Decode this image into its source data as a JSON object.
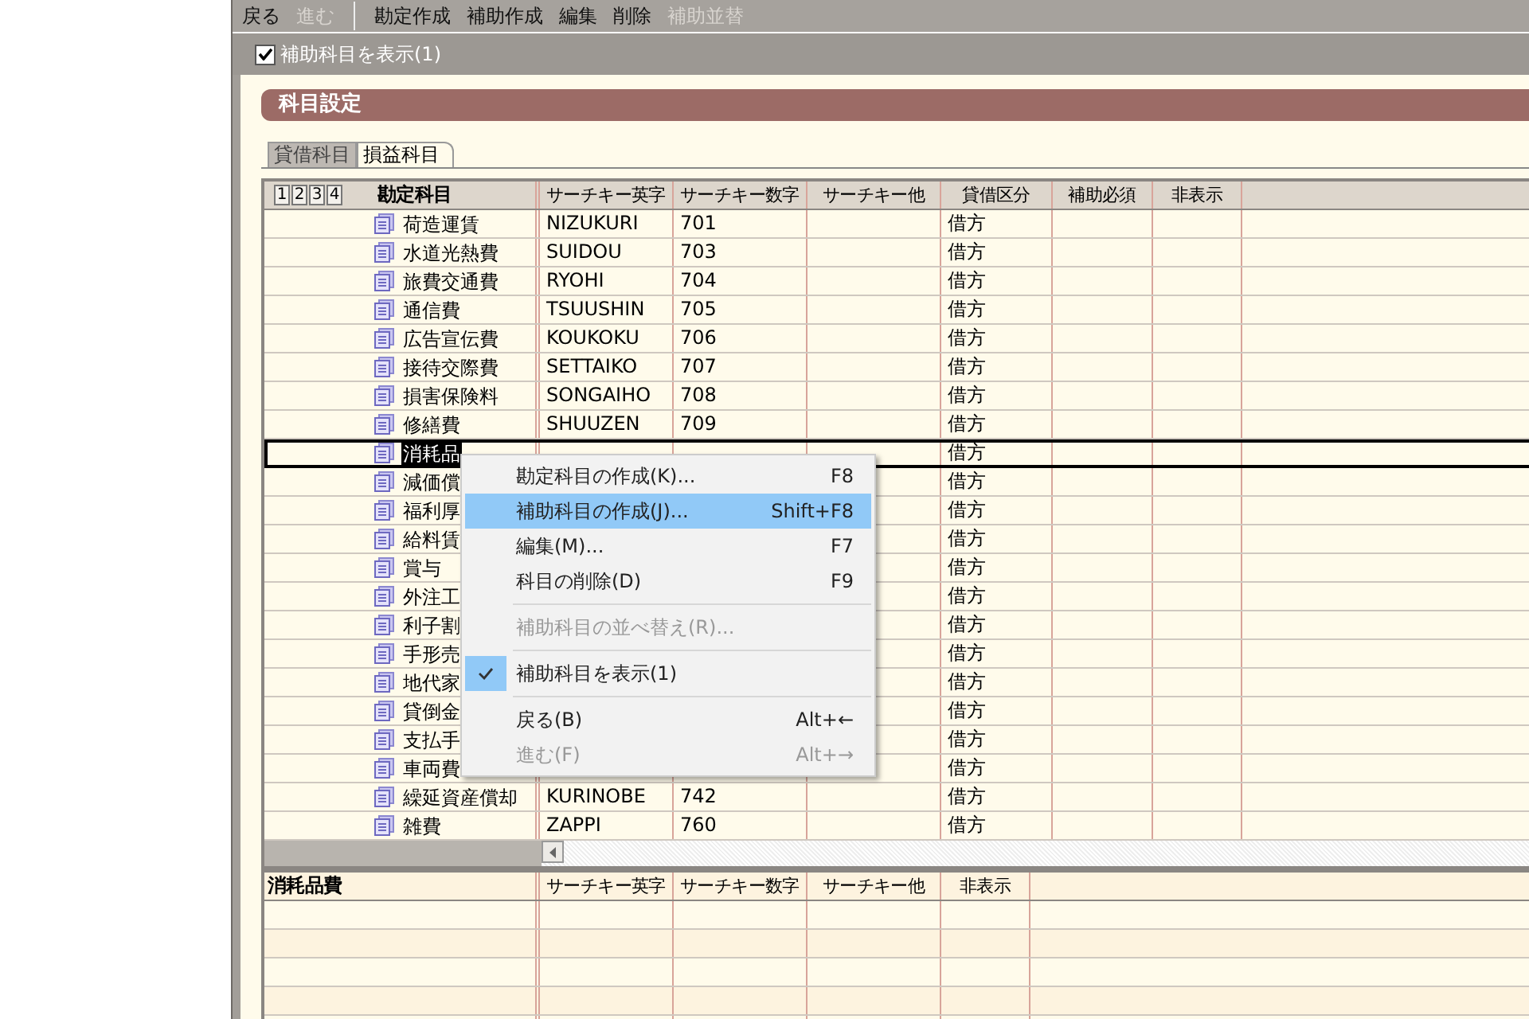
{
  "toolbar": [
    {
      "kind": "button",
      "label": "戻る",
      "disabled": false
    },
    {
      "kind": "button",
      "label": "進む",
      "disabled": true
    },
    {
      "kind": "separator"
    },
    {
      "kind": "button",
      "label": "勘定作成",
      "disabled": false
    },
    {
      "kind": "button",
      "label": "補助作成",
      "disabled": false
    },
    {
      "kind": "button",
      "label": "編集",
      "disabled": false
    },
    {
      "kind": "button",
      "label": "削除",
      "disabled": false
    },
    {
      "kind": "button",
      "label": "補助並替",
      "disabled": true
    }
  ],
  "show_sub_checkbox": {
    "label": "補助科目を表示(1)",
    "checked": true
  },
  "panel_title": "科目設定",
  "tabs": [
    {
      "label": "貸借科目",
      "selected": false
    },
    {
      "label": "損益科目",
      "selected": true
    }
  ],
  "grid": {
    "levels": [
      "1",
      "2",
      "3",
      "4"
    ],
    "columns": [
      "勘定科目",
      "サーチキー英字",
      "サーチキー数字",
      "サーチキー他",
      "貸借区分",
      "補助必須",
      "非表示"
    ],
    "rows": [
      {
        "name": "荷造運賃",
        "en": "NIZUKURI",
        "num": "701",
        "side": "借方",
        "selected": false
      },
      {
        "name": "水道光熱費",
        "en": "SUIDOU",
        "num": "703",
        "side": "借方",
        "selected": false
      },
      {
        "name": "旅費交通費",
        "en": "RYOHI",
        "num": "704",
        "side": "借方",
        "selected": false
      },
      {
        "name": "通信費",
        "en": "TSUUSHIN",
        "num": "705",
        "side": "借方",
        "selected": false
      },
      {
        "name": "広告宣伝費",
        "en": "KOUKOKU",
        "num": "706",
        "side": "借方",
        "selected": false
      },
      {
        "name": "接待交際費",
        "en": "SETTAIKO",
        "num": "707",
        "side": "借方",
        "selected": false
      },
      {
        "name": "損害保険料",
        "en": "SONGAIHO",
        "num": "708",
        "side": "借方",
        "selected": false
      },
      {
        "name": "修繕費",
        "en": "SHUUZEN",
        "num": "709",
        "side": "借方",
        "selected": false
      },
      {
        "name": "消耗品",
        "side": "借方",
        "selected": true
      },
      {
        "name": "減価償",
        "side": "借方",
        "selected": false
      },
      {
        "name": "福利厚",
        "side": "借方",
        "selected": false
      },
      {
        "name": "給料賃",
        "side": "借方",
        "selected": false
      },
      {
        "name": "賞与",
        "side": "借方",
        "selected": false
      },
      {
        "name": "外注工",
        "side": "借方",
        "selected": false
      },
      {
        "name": "利子割",
        "side": "借方",
        "selected": false
      },
      {
        "name": "手形売",
        "side": "借方",
        "selected": false
      },
      {
        "name": "地代家",
        "side": "借方",
        "selected": false
      },
      {
        "name": "貸倒金",
        "side": "借方",
        "selected": false
      },
      {
        "name": "支払手",
        "side": "借方",
        "selected": false
      },
      {
        "name": "車両費",
        "side": "借方",
        "selected": false
      },
      {
        "name": "繰延資産償却",
        "en": "KURINOBE",
        "num": "742",
        "side": "借方",
        "selected": false
      },
      {
        "name": "雑費",
        "en": "ZAPPI",
        "num": "760",
        "side": "借方",
        "selected": false
      }
    ]
  },
  "sub_grid": {
    "columns": [
      "消耗品費",
      "サーチキー英字",
      "サーチキー数字",
      "サーチキー他",
      "非表示"
    ]
  },
  "context_menu": {
    "items": [
      {
        "kind": "item",
        "label": "勘定科目の作成(K)...",
        "shortcut": "F8",
        "disabled": false,
        "checked": false,
        "selected": false
      },
      {
        "kind": "item",
        "label": "補助科目の作成(J)...",
        "shortcut": "Shift+F8",
        "disabled": false,
        "checked": false,
        "selected": true
      },
      {
        "kind": "item",
        "label": "編集(M)...",
        "shortcut": "F7",
        "disabled": false,
        "checked": false,
        "selected": false
      },
      {
        "kind": "item",
        "label": "科目の削除(D)",
        "shortcut": "F9",
        "disabled": false,
        "checked": false,
        "selected": false
      },
      {
        "kind": "separator"
      },
      {
        "kind": "item",
        "label": "補助科目の並べ替え(R)...",
        "disabled": true,
        "checked": false,
        "selected": false
      },
      {
        "kind": "separator"
      },
      {
        "kind": "item",
        "label": "補助科目を表示(1)",
        "disabled": false,
        "checked": true,
        "selected": false
      },
      {
        "kind": "separator"
      },
      {
        "kind": "item",
        "label": "戻る(B)",
        "shortcut": "Alt+←",
        "disabled": false,
        "checked": false,
        "selected": false
      },
      {
        "kind": "item",
        "label": "進む(F)",
        "shortcut": "Alt+→",
        "disabled": true,
        "checked": false,
        "selected": false
      }
    ]
  }
}
